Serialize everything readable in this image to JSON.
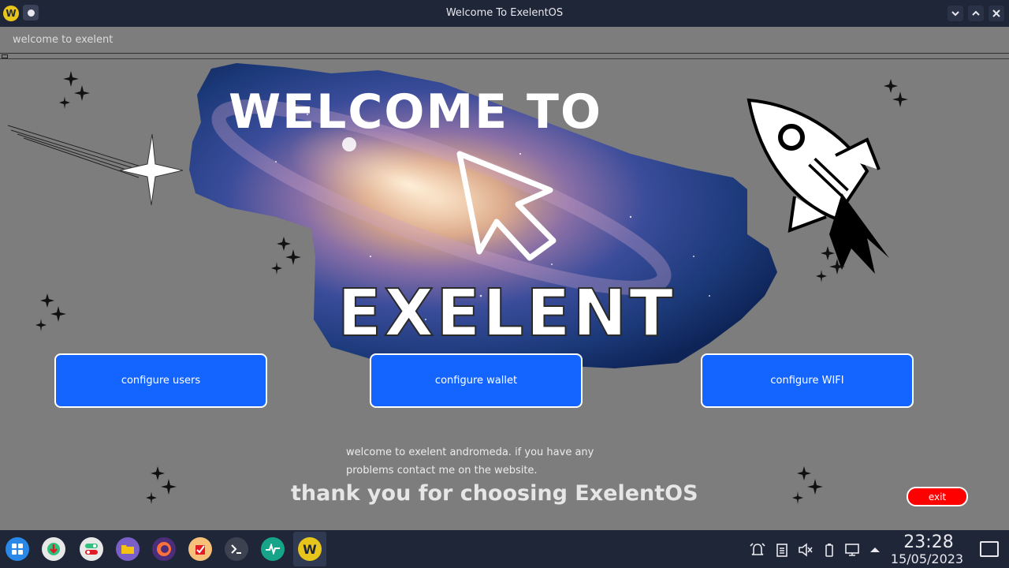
{
  "window": {
    "title": "Welcome To ExelentOS",
    "app_icon_letter": "W",
    "controls": [
      "minimize",
      "maximize",
      "close"
    ]
  },
  "subheader": {
    "label": "welcome to exelent"
  },
  "hero": {
    "line1": "WELCOME TO",
    "line2": "EXELENT"
  },
  "buttons": {
    "users": "configure users",
    "wallet": "configure wallet",
    "wifi": "configure WIFI",
    "exit": "exit"
  },
  "message": {
    "line1": "welcome to exelent andromeda. if you have any",
    "line2": "problems contact me on the website."
  },
  "thanks": "thank you for choosing ExelentOS",
  "colors": {
    "background": "#7d7d7d",
    "titlebar": "#1f2638",
    "button_blue": "#1464ff",
    "exit_red": "#ff0000"
  },
  "taskbar": {
    "apps": [
      "app-launcher-icon",
      "software-center-icon",
      "settings-toggle-icon",
      "file-manager-icon",
      "firefox-icon",
      "clipboard-app-icon",
      "terminal-icon",
      "system-monitor-icon",
      "exelent-welcome-icon"
    ],
    "tray": [
      "notifications-icon",
      "clipboard-icon",
      "volume-muted-icon",
      "battery-icon",
      "network-icon",
      "tray-expand-icon"
    ],
    "time": "23:28",
    "date": "15/05/2023"
  }
}
